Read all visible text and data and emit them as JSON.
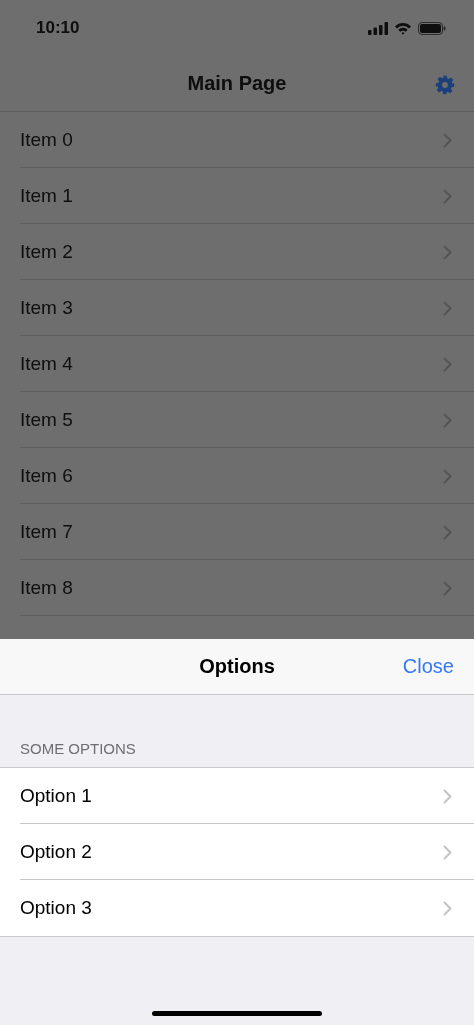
{
  "status_bar": {
    "time": "10:10"
  },
  "nav_bar": {
    "title": "Main Page"
  },
  "items": [
    {
      "label": "Item 0"
    },
    {
      "label": "Item 1"
    },
    {
      "label": "Item 2"
    },
    {
      "label": "Item 3"
    },
    {
      "label": "Item 4"
    },
    {
      "label": "Item 5"
    },
    {
      "label": "Item 6"
    },
    {
      "label": "Item 7"
    },
    {
      "label": "Item 8"
    }
  ],
  "sheet": {
    "title": "Options",
    "close_button": "Close",
    "section_header": "SOME OPTIONS",
    "options": [
      {
        "label": "Option 1"
      },
      {
        "label": "Option 2"
      },
      {
        "label": "Option 3"
      }
    ]
  }
}
